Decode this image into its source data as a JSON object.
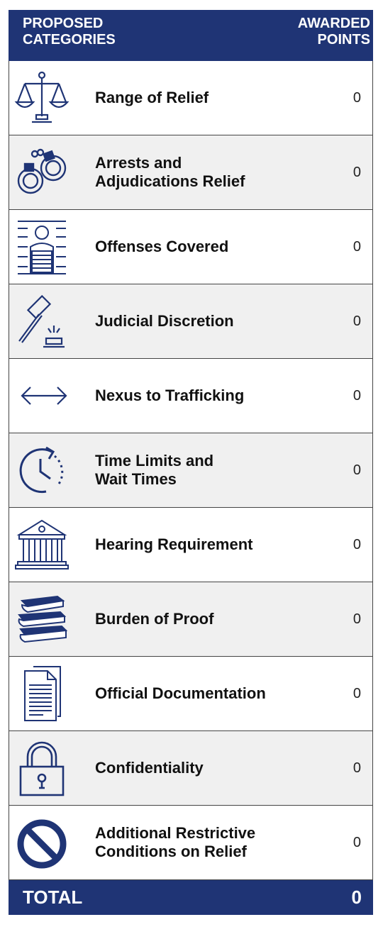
{
  "header": {
    "left_line1": "PROPOSED",
    "left_line2": "CATEGORIES",
    "right_line1": "AWARDED",
    "right_line2": "POINTS"
  },
  "colors": {
    "navy": "#1f3475",
    "alt_row": "#f0f0f0",
    "icon": "#1f3475"
  },
  "rows": [
    {
      "label": "Range of Relief",
      "points": "0",
      "icon": "scales-icon"
    },
    {
      "label": "Arrests and\nAdjudications Relief",
      "points": "0",
      "icon": "handcuffs-icon"
    },
    {
      "label": "Offenses Covered",
      "points": "0",
      "icon": "mugshot-icon"
    },
    {
      "label": "Judicial Discretion",
      "points": "0",
      "icon": "gavel-icon"
    },
    {
      "label": "Nexus to Trafficking",
      "points": "0",
      "icon": "double-arrow-icon"
    },
    {
      "label": "Time Limits and\nWait Times",
      "points": "0",
      "icon": "clock-icon"
    },
    {
      "label": "Hearing Requirement",
      "points": "0",
      "icon": "courthouse-icon"
    },
    {
      "label": "Burden of Proof",
      "points": "0",
      "icon": "books-icon"
    },
    {
      "label": "Official Documentation",
      "points": "0",
      "icon": "document-icon"
    },
    {
      "label": "Confidentiality",
      "points": "0",
      "icon": "padlock-icon"
    },
    {
      "label": "Additional Restrictive\nConditions on Relief",
      "points": "0",
      "icon": "prohibited-icon"
    }
  ],
  "total": {
    "label": "TOTAL",
    "value": "0"
  }
}
